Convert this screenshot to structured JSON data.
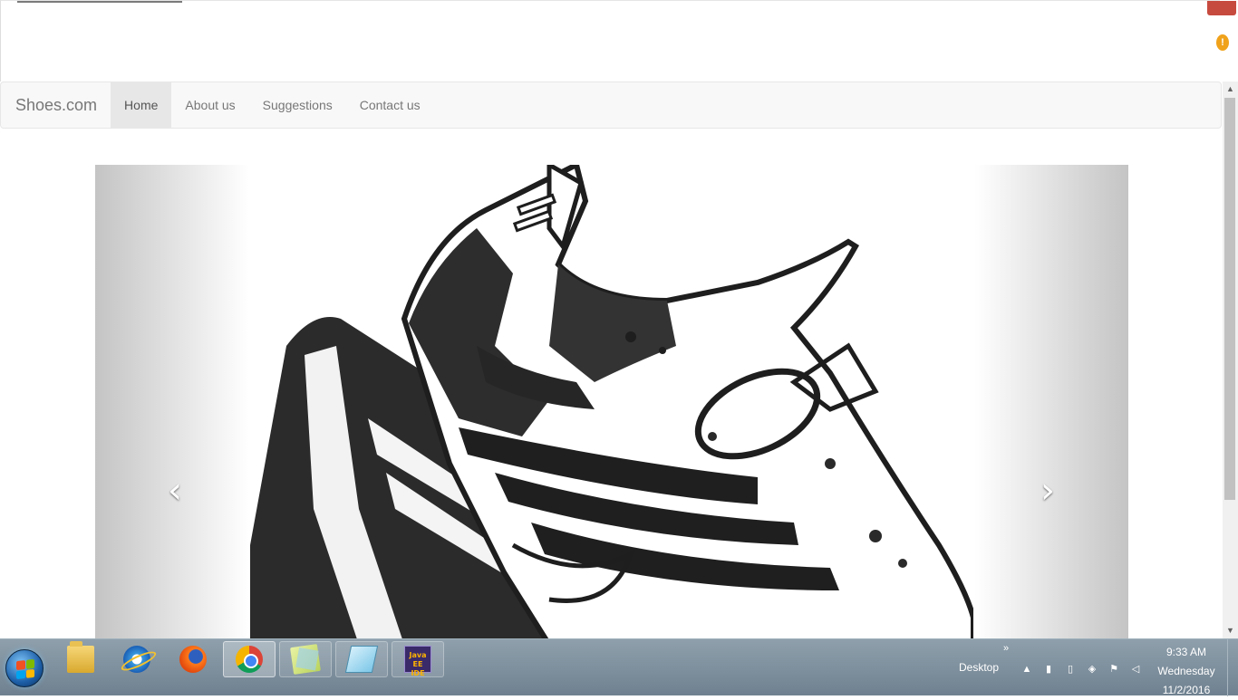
{
  "browser": {
    "notification_badge": "!"
  },
  "navbar": {
    "brand": "Shoes.com",
    "links": [
      {
        "label": "Home",
        "active": true
      },
      {
        "label": "About us",
        "active": false
      },
      {
        "label": "Suggestions",
        "active": false
      },
      {
        "label": "Contact us",
        "active": false
      }
    ]
  },
  "carousel": {
    "slide_image": "sneaker line drawing",
    "prev_glyph": "‹",
    "next_glyph": "›"
  },
  "taskbar": {
    "apps": [
      {
        "name": "windows-explorer-icon"
      },
      {
        "name": "internet-explorer-icon"
      },
      {
        "name": "firefox-icon"
      },
      {
        "name": "chrome-icon"
      },
      {
        "name": "sticky-notes-icon"
      },
      {
        "name": "eraser-app-icon"
      },
      {
        "name": "java-ee-ide-icon",
        "label": "Java EE IDE"
      }
    ],
    "desktop_label": "Desktop",
    "chevrons": "»",
    "clock": {
      "time": "9:33 AM",
      "day": "Wednesday",
      "date": "11/2/2016"
    }
  },
  "colors": {
    "navbar_bg": "#f8f8f8",
    "active_link_bg": "#e7e7e7",
    "taskbar": "#7d8e9b"
  }
}
